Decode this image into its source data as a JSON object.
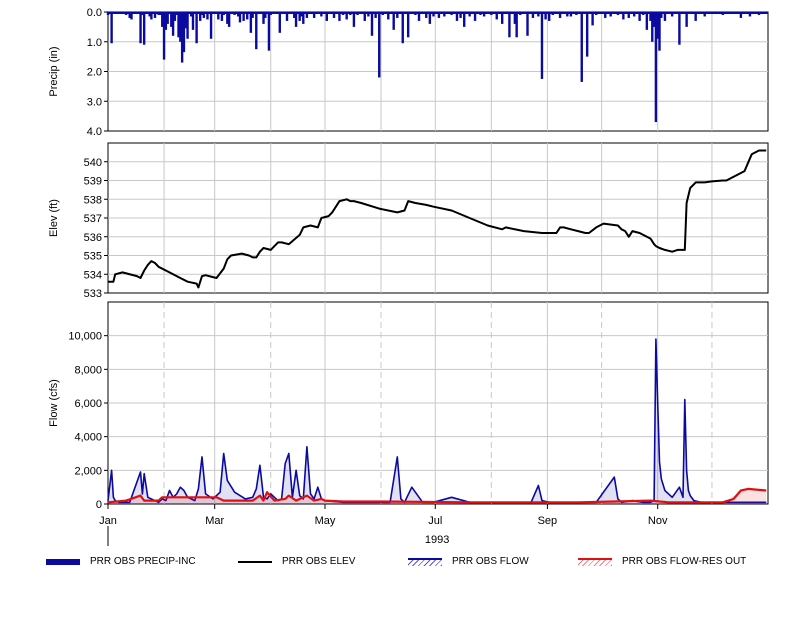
{
  "chart_data": [
    {
      "type": "bar",
      "ylabel": "Precip (in)",
      "ylim": [
        0,
        4.0
      ],
      "y_inverted": true,
      "yticks": [
        "0.0",
        "1.0",
        "2.0",
        "3.0",
        "4.0"
      ],
      "grid": true,
      "color": "#0a0aa0",
      "series": [
        {
          "name": "PRR OBS PRECIP-INC",
          "x_day": [
            0,
            2,
            10,
            12,
            13,
            18,
            19,
            20,
            23,
            24,
            26,
            28,
            29,
            30,
            31,
            32,
            33,
            35,
            36,
            37,
            38,
            39,
            40,
            41,
            42,
            43,
            44,
            46,
            47,
            49,
            51,
            52,
            53,
            55,
            57,
            61,
            63,
            64,
            66,
            67,
            70,
            72,
            73,
            75,
            77,
            79,
            80,
            82,
            86,
            87,
            89,
            90,
            95,
            99,
            103,
            104,
            106,
            107,
            108,
            110,
            114,
            118,
            121,
            125,
            128,
            130,
            132,
            134,
            136,
            138,
            142,
            144,
            146,
            148,
            150,
            152,
            155,
            158,
            160,
            163,
            166,
            170,
            172,
            176,
            178,
            180,
            183,
            186,
            190,
            193,
            195,
            197,
            200,
            203,
            206,
            208,
            212,
            215,
            218,
            222,
            225,
            226,
            228,
            232,
            235,
            238,
            240,
            242,
            244,
            246,
            250,
            254,
            256,
            259,
            262,
            265,
            268,
            270,
            275,
            278,
            282,
            285,
            288,
            291,
            294,
            296,
            298,
            300,
            301,
            302,
            303,
            304,
            305,
            306,
            308,
            312,
            316,
            320,
            325,
            330,
            340,
            350,
            355,
            360
          ],
          "values": [
            0.1,
            1.05,
            0.1,
            0.2,
            0.25,
            1.05,
            0.1,
            1.1,
            0.15,
            0.25,
            0.2,
            0.1,
            0.1,
            0.5,
            1.6,
            0.6,
            0.4,
            0.5,
            0.8,
            0.3,
            0.1,
            0.85,
            1.0,
            1.7,
            1.35,
            0.55,
            0.9,
            0.15,
            0.6,
            1.05,
            0.3,
            0.1,
            0.2,
            0.25,
            0.9,
            0.25,
            0.3,
            0.1,
            0.4,
            0.5,
            0.1,
            0.15,
            0.35,
            0.3,
            0.25,
            0.7,
            0.2,
            1.25,
            0.4,
            0.2,
            1.3,
            0.1,
            0.7,
            0.3,
            0.2,
            0.5,
            0.3,
            0.15,
            0.4,
            0.2,
            0.2,
            0.15,
            0.3,
            0.2,
            0.3,
            0.1,
            0.25,
            0.1,
            0.5,
            0.1,
            0.3,
            0.15,
            0.8,
            0.2,
            2.2,
            0.1,
            0.25,
            0.6,
            0.2,
            1.05,
            0.85,
            0.1,
            0.3,
            0.2,
            0.4,
            0.15,
            0.2,
            0.15,
            0.1,
            0.3,
            0.2,
            0.5,
            0.15,
            0.3,
            0.1,
            0.15,
            0.1,
            0.25,
            0.4,
            0.85,
            0.4,
            0.85,
            0.1,
            0.8,
            0.2,
            0.15,
            2.25,
            0.25,
            0.3,
            0.1,
            0.2,
            0.15,
            0.15,
            0.1,
            2.35,
            1.5,
            0.45,
            0.1,
            0.2,
            0.15,
            0.1,
            0.25,
            0.2,
            0.15,
            0.3,
            0.1,
            0.6,
            0.3,
            1.0,
            0.5,
            3.7,
            0.9,
            1.3,
            0.2,
            0.3,
            0.15,
            1.1,
            0.5,
            0.3,
            0.15,
            0.1,
            0.2,
            0.15,
            0.1
          ]
        }
      ]
    },
    {
      "type": "line",
      "ylabel": "Elev (ft)",
      "ylim": [
        533,
        541
      ],
      "yticks": [
        "533",
        "534",
        "535",
        "536",
        "537",
        "538",
        "539",
        "540"
      ],
      "grid": true,
      "series": [
        {
          "name": "PRR OBS ELEV",
          "color": "#000000",
          "x_day": [
            0,
            3,
            4,
            8,
            16,
            18,
            20,
            22,
            24,
            26,
            28,
            34,
            40,
            44,
            49,
            50,
            52,
            54,
            58,
            60,
            64,
            66,
            68,
            74,
            78,
            80,
            82,
            84,
            86,
            90,
            94,
            96,
            100,
            106,
            108,
            112,
            116,
            118,
            122,
            124,
            128,
            132,
            134,
            136,
            140,
            150,
            160,
            164,
            166,
            170,
            176,
            180,
            190,
            200,
            210,
            218,
            220,
            230,
            240,
            248,
            250,
            252,
            256,
            260,
            264,
            266,
            270,
            274,
            282,
            284,
            286,
            288,
            290,
            294,
            300,
            302,
            303,
            305,
            308,
            312,
            315,
            319,
            320,
            322,
            325,
            330,
            334,
            340,
            342,
            346,
            352,
            356,
            360,
            364
          ],
          "values": [
            533.6,
            533.6,
            534.0,
            534.1,
            533.9,
            533.8,
            534.2,
            534.5,
            534.7,
            534.6,
            534.4,
            534.1,
            533.8,
            533.6,
            533.5,
            533.3,
            533.9,
            533.95,
            533.85,
            533.8,
            534.3,
            534.8,
            535.0,
            535.1,
            535.0,
            534.9,
            534.9,
            535.2,
            535.4,
            535.3,
            535.7,
            535.7,
            535.6,
            536.1,
            536.5,
            536.6,
            536.5,
            537.0,
            537.1,
            537.3,
            537.9,
            538.0,
            537.9,
            537.9,
            537.8,
            537.5,
            537.3,
            537.4,
            537.9,
            537.8,
            537.7,
            537.6,
            537.4,
            537.0,
            536.6,
            536.4,
            536.5,
            536.3,
            536.2,
            536.2,
            536.5,
            536.5,
            536.4,
            536.3,
            536.2,
            536.2,
            536.5,
            536.7,
            536.6,
            536.4,
            536.3,
            536.0,
            536.3,
            536.2,
            535.9,
            535.6,
            535.5,
            535.4,
            535.3,
            535.2,
            535.3,
            535.3,
            537.8,
            538.6,
            538.9,
            538.9,
            538.95,
            539.0,
            539.0,
            539.2,
            539.5,
            540.4,
            540.6,
            540.6
          ]
        }
      ]
    },
    {
      "type": "line",
      "ylabel": "Flow (cfs)",
      "xlabel": "1993",
      "ylim": [
        0,
        12000
      ],
      "yticks": [
        "0",
        "2,000",
        "4,000",
        "6,000",
        "8,000",
        "10,000"
      ],
      "xticks": [
        "Jan",
        "Mar",
        "May",
        "Jul",
        "Sep",
        "Nov"
      ],
      "grid": true,
      "series": [
        {
          "name": "PRR OBS FLOW",
          "color": "#0a0aa0",
          "x_day": [
            0,
            2,
            3,
            4,
            6,
            12,
            18,
            19,
            20,
            22,
            26,
            28,
            30,
            32,
            34,
            36,
            38,
            40,
            42,
            44,
            46,
            48,
            50,
            52,
            54,
            58,
            62,
            64,
            66,
            70,
            76,
            80,
            82,
            84,
            86,
            88,
            90,
            92,
            94,
            96,
            98,
            100,
            102,
            104,
            106,
            108,
            110,
            112,
            114,
            116,
            118,
            120,
            130,
            156,
            160,
            162,
            164,
            168,
            174,
            180,
            190,
            200,
            212,
            220,
            228,
            234,
            238,
            240,
            244,
            250,
            256,
            260,
            270,
            280,
            282,
            284,
            290,
            296,
            300,
            302,
            303,
            304,
            305,
            306,
            308,
            312,
            316,
            318,
            319,
            320,
            321,
            322,
            324,
            328,
            334,
            340,
            346,
            352,
            358,
            364
          ],
          "values": [
            200,
            2000,
            400,
            200,
            100,
            100,
            1900,
            600,
            1800,
            400,
            200,
            100,
            300,
            200,
            800,
            400,
            600,
            1000,
            800,
            400,
            300,
            200,
            900,
            2800,
            600,
            300,
            700,
            3000,
            1400,
            700,
            300,
            400,
            900,
            2300,
            400,
            300,
            600,
            400,
            200,
            300,
            2400,
            3000,
            400,
            2000,
            500,
            300,
            3400,
            600,
            300,
            1000,
            300,
            200,
            100,
            100,
            2800,
            300,
            100,
            1000,
            100,
            100,
            400,
            100,
            100,
            100,
            100,
            100,
            1100,
            200,
            100,
            100,
            100,
            100,
            100,
            1600,
            300,
            100,
            200,
            100,
            100,
            200,
            9800,
            6000,
            2500,
            1500,
            800,
            400,
            1000,
            400,
            6200,
            2000,
            800,
            500,
            200,
            100,
            100,
            100,
            100,
            100,
            100,
            100
          ]
        },
        {
          "name": "PRR OBS FLOW-RES OUT",
          "color": "#e01010",
          "x_day": [
            0,
            10,
            18,
            20,
            28,
            30,
            60,
            64,
            70,
            80,
            84,
            86,
            88,
            92,
            98,
            100,
            104,
            110,
            114,
            118,
            120,
            130,
            150,
            200,
            240,
            260,
            280,
            300,
            310,
            330,
            340,
            346,
            350,
            354,
            364
          ],
          "values": [
            100,
            200,
            500,
            200,
            200,
            400,
            400,
            200,
            200,
            200,
            500,
            200,
            700,
            200,
            300,
            500,
            200,
            500,
            200,
            300,
            200,
            150,
            150,
            100,
            100,
            100,
            150,
            200,
            100,
            100,
            100,
            300,
            800,
            900,
            800
          ]
        }
      ]
    }
  ],
  "legend": {
    "precip": "PRR OBS PRECIP-INC",
    "elev": "PRR OBS ELEV",
    "flow": "PRR OBS FLOW",
    "res": "PRR OBS FLOW-RES OUT"
  }
}
